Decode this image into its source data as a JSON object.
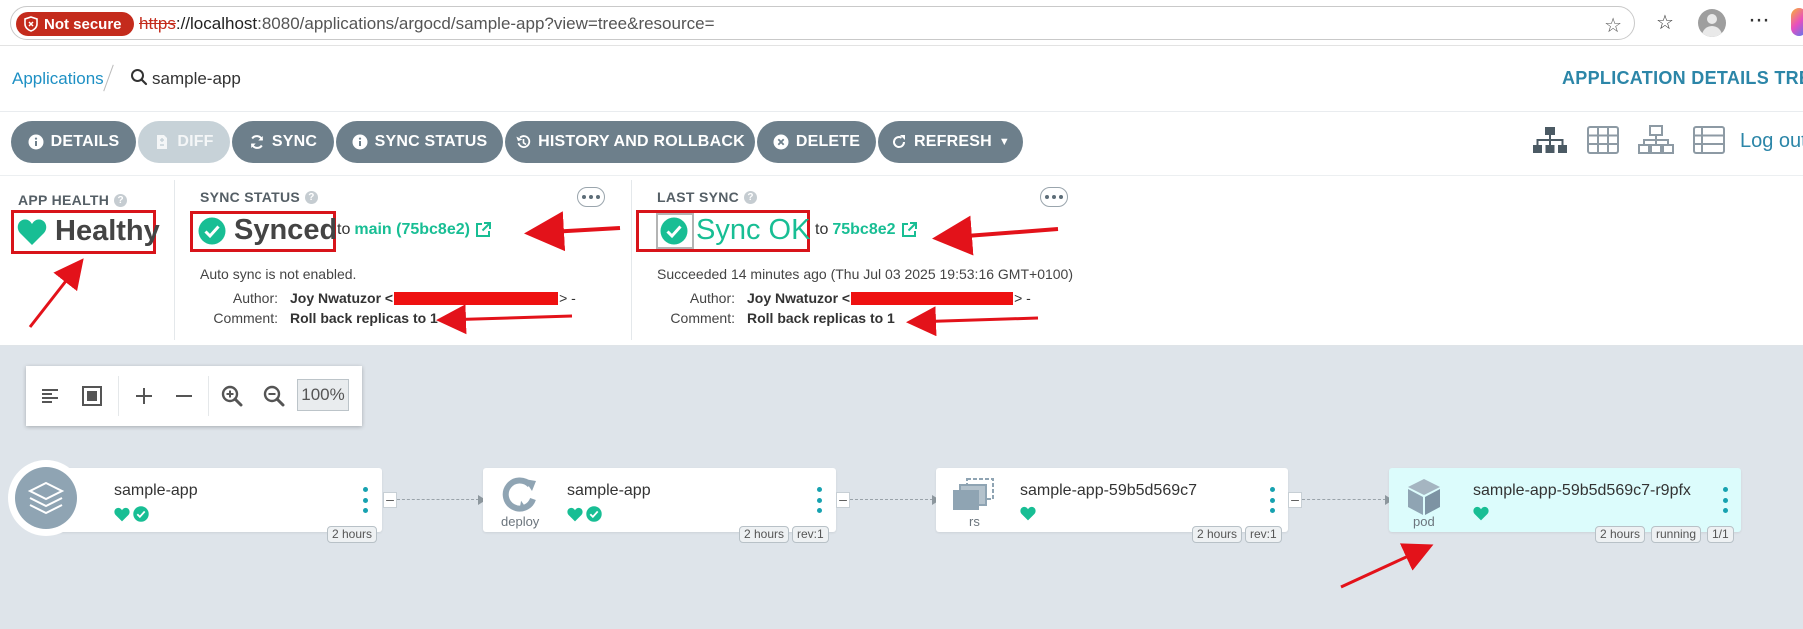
{
  "browser": {
    "not_secure": "Not secure",
    "url_proto": "https",
    "url_host": "://localhost",
    "url_rest": ":8080/applications/argocd/sample-app?view=tree&resource="
  },
  "header": {
    "breadcrumb_apps": "Applications",
    "current_app": "sample-app",
    "page_title": "APPLICATION DETAILS TREE"
  },
  "toolbar": {
    "details": "DETAILS",
    "diff": "DIFF",
    "sync": "SYNC",
    "sync_status": "SYNC STATUS",
    "history": "HISTORY AND ROLLBACK",
    "delete": "DELETE",
    "refresh": "REFRESH",
    "logout": "Log out"
  },
  "app_health": {
    "label": "APP HEALTH",
    "value": "Healthy"
  },
  "sync_status": {
    "label": "SYNC STATUS",
    "value": "Synced",
    "to": "to",
    "target": "main (75bc8e2)",
    "auto_sync": "Auto sync is not enabled.",
    "author_key": "Author:",
    "author_name": "Joy Nwatuzor <",
    "author_tail": "> -",
    "comment_key": "Comment:",
    "comment": "Roll back replicas to 1"
  },
  "last_sync": {
    "label": "LAST SYNC",
    "value": "Sync OK",
    "to": "to",
    "target": "75bc8e2",
    "succeeded": "Succeeded 14 minutes ago (Thu Jul 03 2025 19:53:16 GMT+0100)",
    "author_key": "Author:",
    "author_name": "Joy Nwatuzor <",
    "author_tail": "> -",
    "comment_key": "Comment:",
    "comment": "Roll back replicas to 1"
  },
  "zoom": {
    "level": "100%"
  },
  "nodes": [
    {
      "title": "sample-app",
      "kind": "",
      "tags": [
        "2 hours"
      ]
    },
    {
      "title": "sample-app",
      "kind": "deploy",
      "tags": [
        "2 hours",
        "rev:1"
      ]
    },
    {
      "title": "sample-app-59b5d569c7",
      "kind": "rs",
      "tags": [
        "2 hours",
        "rev:1"
      ]
    },
    {
      "title": "sample-app-59b5d569c7-r9pfx",
      "kind": "pod",
      "tags": [
        "2 hours",
        "running",
        "1/1"
      ]
    }
  ],
  "colors": {
    "healthy": "#18be94",
    "button": "#6d7f8b",
    "accent": "#2c86a8",
    "annotation": "#d8141a"
  }
}
